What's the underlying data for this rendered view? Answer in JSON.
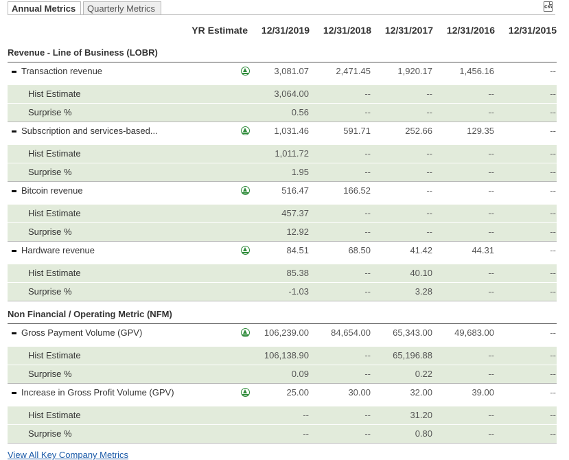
{
  "tabs": {
    "annual": "Annual Metrics",
    "quarterly": "Quarterly Metrics",
    "active": "annual"
  },
  "export": {
    "icon": "csv-icon",
    "label": "csv"
  },
  "columns": [
    "YR Estimate",
    "12/31/2019",
    "12/31/2018",
    "12/31/2017",
    "12/31/2016",
    "12/31/2015"
  ],
  "sections": [
    {
      "title": "Revenue - Line of Business (LOBR)",
      "metrics": [
        {
          "name": "Transaction revenue",
          "values": [
            "3,081.07",
            "2,471.45",
            "1,920.17",
            "1,456.16",
            "--"
          ],
          "hist_estimate": [
            "3,064.00",
            "--",
            "--",
            "--",
            "--"
          ],
          "surprise": [
            "0.56",
            "--",
            "--",
            "--",
            "--"
          ]
        },
        {
          "name": "Subscription and services-based...",
          "values": [
            "1,031.46",
            "591.71",
            "252.66",
            "129.35",
            "--"
          ],
          "hist_estimate": [
            "1,011.72",
            "--",
            "--",
            "--",
            "--"
          ],
          "surprise": [
            "1.95",
            "--",
            "--",
            "--",
            "--"
          ]
        },
        {
          "name": "Bitcoin revenue",
          "values": [
            "516.47",
            "166.52",
            "--",
            "--",
            "--"
          ],
          "hist_estimate": [
            "457.37",
            "--",
            "--",
            "--",
            "--"
          ],
          "surprise": [
            "12.92",
            "--",
            "--",
            "--",
            "--"
          ]
        },
        {
          "name": "Hardware revenue",
          "values": [
            "84.51",
            "68.50",
            "41.42",
            "44.31",
            "--"
          ],
          "hist_estimate": [
            "85.38",
            "--",
            "40.10",
            "--",
            "--"
          ],
          "surprise": [
            "-1.03",
            "--",
            "3.28",
            "--",
            "--"
          ]
        }
      ]
    },
    {
      "title": "Non Financial / Operating Metric (NFM)",
      "metrics": [
        {
          "name": "Gross Payment Volume (GPV)",
          "values": [
            "106,239.00",
            "84,654.00",
            "65,343.00",
            "49,683.00",
            "--"
          ],
          "hist_estimate": [
            "106,138.90",
            "--",
            "65,196.88",
            "--",
            "--"
          ],
          "surprise": [
            "0.09",
            "--",
            "0.22",
            "--",
            "--"
          ]
        },
        {
          "name": "Increase in Gross Profit Volume (GPV)",
          "values": [
            "25.00",
            "30.00",
            "32.00",
            "39.00",
            "--"
          ],
          "hist_estimate": [
            "--",
            "--",
            "31.20",
            "--",
            "--"
          ],
          "surprise": [
            "--",
            "--",
            "0.80",
            "--",
            "--"
          ]
        }
      ]
    }
  ],
  "row_labels": {
    "hist_estimate": "Hist Estimate",
    "surprise": "Surprise %"
  },
  "footer": {
    "link": "View All Key Company Metrics"
  },
  "colors": {
    "trend_icon": "#2e8b3a",
    "sub_row_bg": "#e2ebdb",
    "link": "#1a5aa8"
  }
}
